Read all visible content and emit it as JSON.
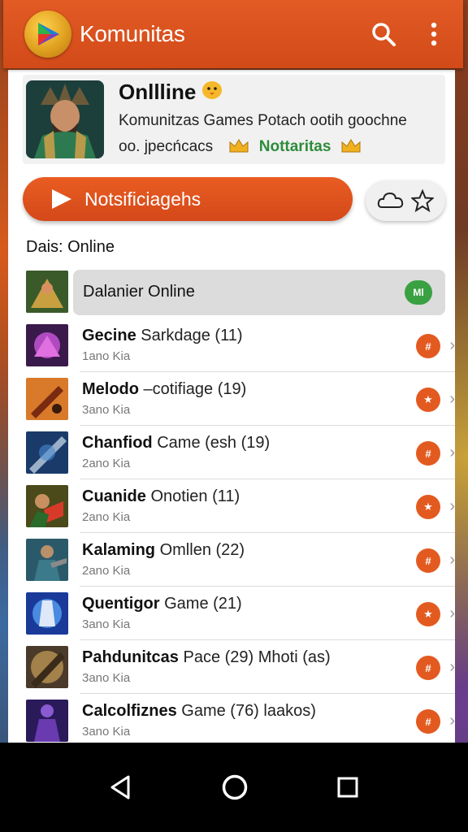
{
  "app_bar": {
    "title": "Komunitas",
    "logo_icon": "play-logo-icon",
    "search_icon": "search-icon",
    "menu_icon": "more-vert-icon",
    "color": "#d84f1c"
  },
  "profile": {
    "title": "Onllline",
    "desc_line1": "Komunitzas Games Potach ootih goochne",
    "desc_line2": "oo. jpecńcacs",
    "tag": "Nottaritas"
  },
  "notif_button": {
    "label": "Notsificiagehs"
  },
  "section_label": "Dais: Online",
  "highlight_row": {
    "title": "Dalanier Online",
    "badge": "Ml"
  },
  "rows": [
    {
      "title_bold": "Gecine",
      "title_rest": " Sarkdage (11)",
      "sub": "1ano Kia",
      "badge": "#"
    },
    {
      "title_bold": "Melodo",
      "title_rest": " –cotifiage (19)",
      "sub": "3ano Kia",
      "badge": "★"
    },
    {
      "title_bold": "Chanfiod",
      "title_rest": " Came (esh (19)",
      "sub": "2ano Kia",
      "badge": "#"
    },
    {
      "title_bold": "Cuanide",
      "title_rest": " Onotien (11)",
      "sub": "2ano Kia",
      "badge": "★"
    },
    {
      "title_bold": "Kalaming",
      "title_rest": " Omllen (22)",
      "sub": "2ano Kia",
      "badge": "#"
    },
    {
      "title_bold": "Quentigor",
      "title_rest": " Game (21)",
      "sub": "3ano Kia",
      "badge": "★"
    },
    {
      "title_bold": "Pahdunitcas",
      "title_rest": " Pace (29) Mhoti (as)",
      "sub": "3ano Kia",
      "badge": "#"
    },
    {
      "title_bold": "Calcolfiznes",
      "title_rest": " Game (76)  laakos)",
      "sub": "3ano Kia",
      "badge": "#"
    }
  ],
  "thumb_colors": [
    "#3b5a2a",
    "#5a2a6a",
    "#b8541c",
    "#2a5a8a",
    "#6a5a1a",
    "#2a6a5a",
    "#1a4a9a",
    "#5a4a2a",
    "#3a2a7a"
  ]
}
